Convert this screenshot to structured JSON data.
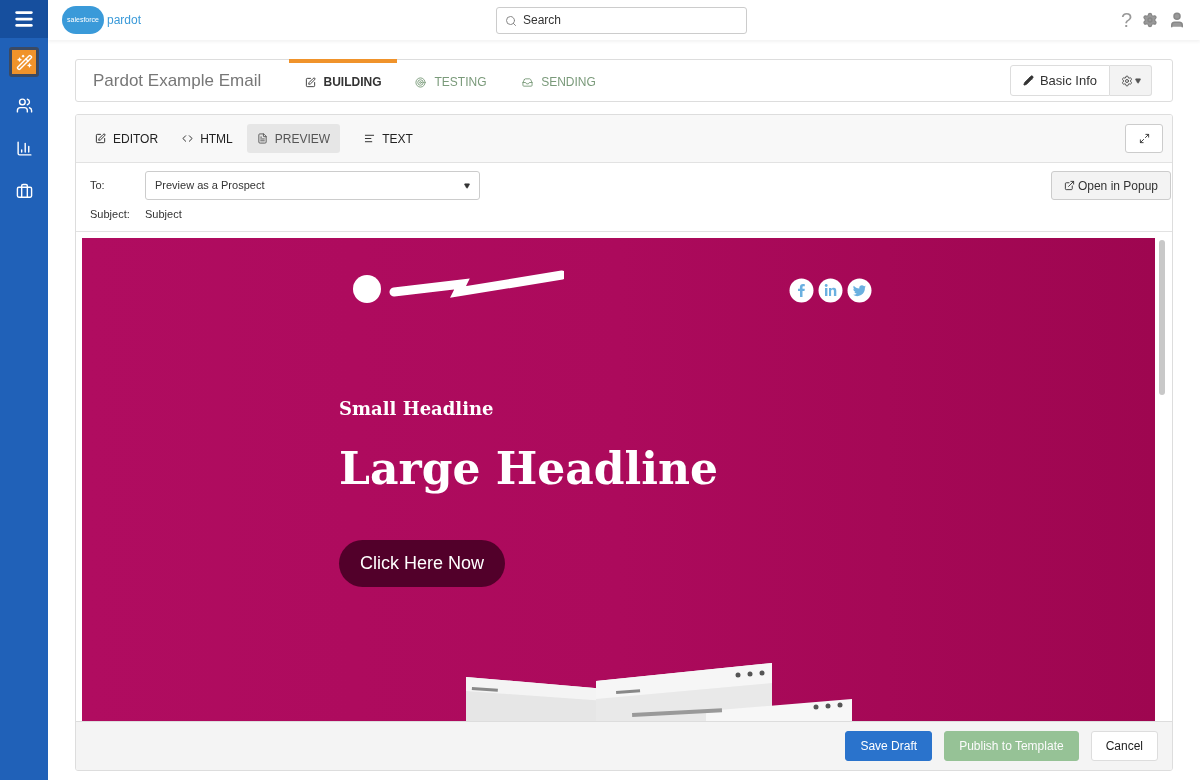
{
  "logo": {
    "cloud_text": "salesforce",
    "product": "pardot"
  },
  "search": {
    "placeholder": "Search"
  },
  "topbar": {
    "help": "?"
  },
  "sidebar": {
    "items": [
      {
        "selected": true
      },
      {
        "selected": false
      },
      {
        "selected": false
      },
      {
        "selected": false
      }
    ]
  },
  "header": {
    "title": "Pardot Example Email",
    "stages": [
      {
        "label": "BUILDING",
        "selected": true
      },
      {
        "label": "TESTING",
        "selected": false
      },
      {
        "label": "SENDING",
        "selected": false
      }
    ],
    "basic_info": "Basic Info"
  },
  "editor": {
    "tabs": [
      {
        "label": "EDITOR",
        "selected": false
      },
      {
        "label": "HTML",
        "selected": false
      },
      {
        "label": "PREVIEW",
        "selected": true
      },
      {
        "label": "TEXT",
        "selected": false
      }
    ],
    "to_label": "To:",
    "to_value": "Preview as a Prospect",
    "subject_label": "Subject:",
    "subject_value": "Subject",
    "open_popup": "Open in Popup"
  },
  "email": {
    "small_headline": "Small Headline",
    "large_headline": "Large Headline",
    "cta": "Click Here Now"
  },
  "footer": {
    "buttons": [
      {
        "label": "Save Draft",
        "kind": "primary",
        "disabled": false
      },
      {
        "label": "Publish to Template",
        "kind": "success",
        "disabled": true
      },
      {
        "label": "Cancel",
        "kind": "default",
        "disabled": false
      }
    ]
  }
}
